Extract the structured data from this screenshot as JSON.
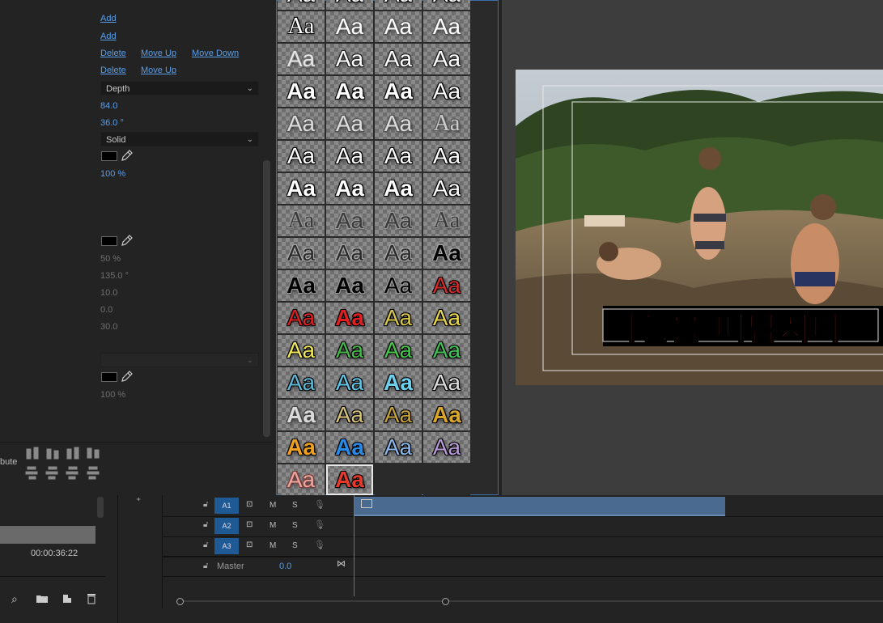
{
  "left_panel": {
    "links": {
      "add_1": "Add",
      "add_2": "Add",
      "delete_1": "Delete",
      "move_up_1": "Move Up",
      "move_down_1": "Move Down",
      "delete_2": "Delete",
      "move_up_2": "Move Up"
    },
    "depth_dropdown": "Depth",
    "size_value": "84.0",
    "angle_value": "36.0 °",
    "fill_dropdown": "Solid",
    "opacity_1": "100 %",
    "opacity_2": "50 %",
    "angle_2": "135.0 °",
    "distance": "10.0",
    "size_2": "0.0",
    "spread": "30.0",
    "opacity_3": "100 %",
    "distribute_label": "bute"
  },
  "style_swatches": {
    "sample_text": "Aa",
    "rows": [
      [
        {
          "c": "#ffffff",
          "s": "#000",
          "f": "Liberation Sans"
        },
        {
          "c": "#ffffff",
          "s": "#000",
          "f": "Liberation Sans"
        },
        {
          "c": "#ffffff",
          "s": "#000",
          "f": "Liberation Sans"
        },
        {
          "c": "#ffffff",
          "s": "#000",
          "f": "Liberation Sans"
        }
      ],
      [
        {
          "c": "#ffffff",
          "s": "#000",
          "f": "Liberation Serif"
        },
        {
          "c": "#ffffff",
          "s": "#555",
          "f": "Liberation Sans"
        },
        {
          "c": "#ffffff",
          "s": "#555",
          "f": "Liberation Sans"
        },
        {
          "c": "#ffffff",
          "s": "#555",
          "f": "Liberation Sans"
        }
      ],
      [
        {
          "c": "#e6e6e6",
          "s": "#777",
          "f": "Liberation Sans"
        },
        {
          "c": "#ffffff",
          "s": "#222",
          "f": "Liberation Sans"
        },
        {
          "c": "#ffffff",
          "s": "#222",
          "f": "Liberation Sans"
        },
        {
          "c": "#ffffff",
          "s": "#222",
          "f": "Liberation Sans"
        }
      ],
      [
        {
          "c": "#ffffff",
          "s": "#000",
          "f": "Liberation Sans",
          "w": "bold"
        },
        {
          "c": "#ffffff",
          "s": "#000",
          "f": "Liberation Sans",
          "w": "bold"
        },
        {
          "c": "#ffffff",
          "s": "#000",
          "f": "Liberation Sans",
          "w": "bold"
        },
        {
          "c": "#ffffff",
          "s": "#000",
          "f": "Liberation Sans"
        }
      ],
      [
        {
          "c": "#dddddd",
          "s": "#555",
          "f": "Liberation Sans"
        },
        {
          "c": "#dddddd",
          "s": "#555",
          "f": "Liberation Sans"
        },
        {
          "c": "#dddddd",
          "s": "#555",
          "f": "Liberation Sans"
        },
        {
          "c": "#cccccc",
          "s": "#555",
          "f": "Liberation Serif"
        }
      ],
      [
        {
          "c": "#ffffff",
          "s": "#000",
          "f": "Liberation Sans"
        },
        {
          "c": "#ffffff",
          "s": "#000",
          "f": "Liberation Sans"
        },
        {
          "c": "#ffffff",
          "s": "#000",
          "f": "Liberation Sans"
        },
        {
          "c": "#ffffff",
          "s": "#000",
          "f": "Liberation Sans"
        }
      ],
      [
        {
          "c": "#ffffff",
          "s": "#000",
          "f": "Liberation Sans",
          "w": "bold"
        },
        {
          "c": "#ffffff",
          "s": "#000",
          "f": "Liberation Sans",
          "w": "bold"
        },
        {
          "c": "#ffffff",
          "s": "#000",
          "f": "Liberation Sans",
          "w": "bold"
        },
        {
          "c": "#ffffff",
          "s": "#000",
          "f": "Liberation Sans"
        }
      ],
      [
        {
          "c": "#3a3a3a",
          "s": "#999",
          "f": "Liberation Serif"
        },
        {
          "c": "#3a3a3a",
          "s": "#999",
          "f": "Liberation Sans"
        },
        {
          "c": "#3a3a3a",
          "s": "#999",
          "f": "Liberation Sans"
        },
        {
          "c": "#3a3a3a",
          "s": "#999",
          "f": "Liberation Serif"
        }
      ],
      [
        {
          "c": "#2a2a2a",
          "s": "#aaa",
          "f": "Liberation Sans"
        },
        {
          "c": "#2a2a2a",
          "s": "#aaa",
          "f": "Liberation Sans"
        },
        {
          "c": "#2a2a2a",
          "s": "#aaa",
          "f": "Liberation Sans"
        },
        {
          "c": "#000000",
          "s": "#aaa",
          "f": "Liberation Sans",
          "w": "bold"
        }
      ],
      [
        {
          "c": "#000000",
          "s": "#999",
          "f": "Liberation Sans",
          "w": "bold"
        },
        {
          "c": "#000000",
          "s": "#999",
          "f": "Liberation Sans",
          "w": "bold"
        },
        {
          "c": "#000000",
          "s": "#999",
          "f": "Liberation Sans"
        },
        {
          "c": "#d42a2a",
          "s": "#000",
          "f": "Liberation Sans"
        }
      ],
      [
        {
          "c": "#e02020",
          "s": "#000",
          "f": "Liberation Sans"
        },
        {
          "c": "#e02020",
          "s": "#000",
          "f": "Liberation Sans",
          "w": "bold"
        },
        {
          "c": "#d7c64a",
          "s": "#000",
          "f": "Liberation Sans"
        },
        {
          "c": "#e8d64e",
          "s": "#000",
          "f": "Liberation Sans"
        }
      ],
      [
        {
          "c": "#f2e95a",
          "s": "#000",
          "f": "Liberation Sans"
        },
        {
          "c": "#48b84a",
          "s": "#000",
          "f": "Liberation Sans"
        },
        {
          "c": "#48c84a",
          "s": "#000",
          "f": "Liberation Sans"
        },
        {
          "c": "#3fc256",
          "s": "#000",
          "f": "Liberation Sans"
        }
      ],
      [
        {
          "c": "#5fb9d8",
          "s": "#000",
          "f": "Liberation Sans"
        },
        {
          "c": "#61c6e8",
          "s": "#000",
          "f": "Liberation Sans"
        },
        {
          "c": "#6cd0ef",
          "s": "#000",
          "f": "Liberation Sans",
          "w": "bold"
        },
        {
          "c": "#dddddd",
          "s": "#000",
          "f": "Liberation Sans"
        }
      ],
      [
        {
          "c": "#dadada",
          "s": "#444",
          "f": "Liberation Sans",
          "w": "bold"
        },
        {
          "c": "#d6c27a",
          "s": "#000",
          "f": "Liberation Sans"
        },
        {
          "c": "#c8a23a",
          "s": "#000",
          "f": "Liberation Sans"
        },
        {
          "c": "#d9a629",
          "s": "#000",
          "f": "Liberation Sans",
          "w": "bold"
        }
      ],
      [
        {
          "c": "#f0a020",
          "s": "#000",
          "f": "Liberation Sans",
          "w": "bold"
        },
        {
          "c": "#2a8ae8",
          "s": "#000",
          "f": "Liberation Sans",
          "w": "bold"
        },
        {
          "c": "#8ab8ec",
          "s": "#000",
          "f": "Liberation Sans"
        },
        {
          "c": "#b89ad8",
          "s": "#000",
          "f": "Liberation Sans"
        }
      ],
      [
        {
          "c": "#e8a8a0",
          "s": "#7a3a3a",
          "f": "Liberation Sans"
        },
        {
          "c": "#e83a2a",
          "s": "#000",
          "f": "Liberation Sans",
          "w": "bold",
          "sel": true
        },
        {
          "empty": true
        },
        {
          "empty": true
        }
      ]
    ]
  },
  "program_monitor": {
    "caption": "여행을 떠납시다"
  },
  "project_panel": {
    "timecode": "00:00:36:22"
  },
  "timeline": {
    "tracks": [
      {
        "id": "A1",
        "m": "M",
        "s": "S"
      },
      {
        "id": "A2",
        "m": "M",
        "s": "S"
      },
      {
        "id": "A3",
        "m": "M",
        "s": "S"
      }
    ],
    "master_label": "Master",
    "master_value": "0.0"
  }
}
